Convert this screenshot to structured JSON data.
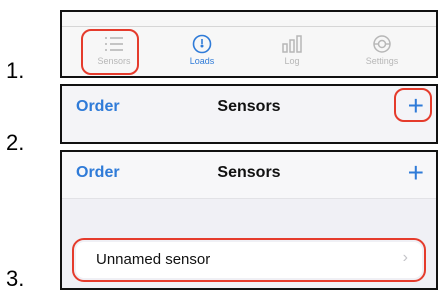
{
  "steps": [
    "1.",
    "2.",
    "3."
  ],
  "tabbar": {
    "tabs": [
      {
        "label": "Sensors",
        "icon": "list-icon"
      },
      {
        "label": "Loads",
        "icon": "gauge-icon"
      },
      {
        "label": "Log",
        "icon": "bars-icon"
      },
      {
        "label": "Settings",
        "icon": "gear-icon"
      }
    ],
    "active_color": "#2f7bd8",
    "muted_color": "#b7b7b7"
  },
  "navbar": {
    "left_label": "Order",
    "title": "Sensors",
    "add_glyph": "+"
  },
  "list": {
    "items": [
      {
        "label": "Unnamed sensor",
        "chevron": "›"
      }
    ]
  },
  "highlight_color": "#e53b2c"
}
